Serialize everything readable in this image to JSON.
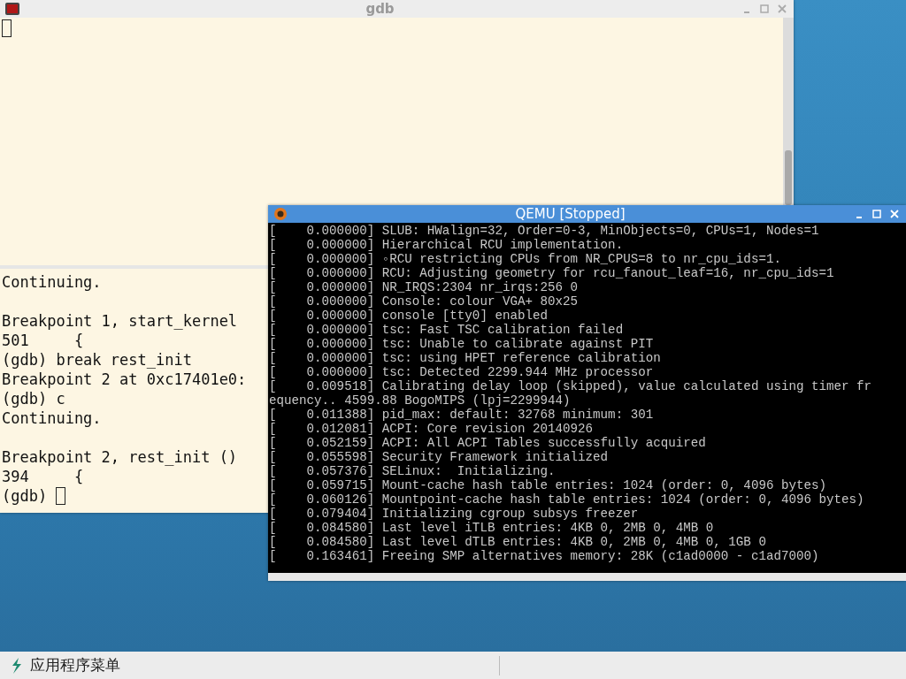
{
  "gdb_window": {
    "title": "gdb",
    "output_groups": [
      [
        "Continuing."
      ],
      [
        "Breakpoint 1, start_kernel",
        "501     {",
        "(gdb) break rest_init",
        "Breakpoint 2 at 0xc17401e0:",
        "(gdb) c",
        "Continuing."
      ],
      [
        "Breakpoint 2, rest_init ()",
        "394     {",
        "(gdb) "
      ]
    ]
  },
  "qemu_window": {
    "title": "QEMU [Stopped]",
    "console_lines": [
      "[    0.000000] SLUB: HWalign=32, Order=0-3, MinObjects=0, CPUs=1, Nodes=1",
      "[    0.000000] Hierarchical RCU implementation.",
      "[    0.000000] ◦RCU restricting CPUs from NR_CPUS=8 to nr_cpu_ids=1.",
      "[    0.000000] RCU: Adjusting geometry for rcu_fanout_leaf=16, nr_cpu_ids=1",
      "[    0.000000] NR_IRQS:2304 nr_irqs:256 0",
      "[    0.000000] Console: colour VGA+ 80x25",
      "[    0.000000] console [tty0] enabled",
      "[    0.000000] tsc: Fast TSC calibration failed",
      "[    0.000000] tsc: Unable to calibrate against PIT",
      "[    0.000000] tsc: using HPET reference calibration",
      "[    0.000000] tsc: Detected 2299.944 MHz processor",
      "[    0.009518] Calibrating delay loop (skipped), value calculated using timer fr",
      "equency.. 4599.88 BogoMIPS (lpj=2299944)",
      "[    0.011388] pid_max: default: 32768 minimum: 301",
      "[    0.012081] ACPI: Core revision 20140926",
      "[    0.052159] ACPI: All ACPI Tables successfully acquired",
      "[    0.055598] Security Framework initialized",
      "[    0.057376] SELinux:  Initializing.",
      "[    0.059715] Mount-cache hash table entries: 1024 (order: 0, 4096 bytes)",
      "[    0.060126] Mountpoint-cache hash table entries: 1024 (order: 0, 4096 bytes)",
      "[    0.079404] Initializing cgroup subsys freezer",
      "[    0.084580] Last level iTLB entries: 4KB 0, 2MB 0, 4MB 0",
      "[    0.084580] Last level dTLB entries: 4KB 0, 2MB 0, 4MB 0, 1GB 0",
      "[    0.163461] Freeing SMP alternatives memory: 28K (c1ad0000 - c1ad7000)"
    ]
  },
  "taskbar": {
    "menu_label": "应用程序菜单"
  }
}
